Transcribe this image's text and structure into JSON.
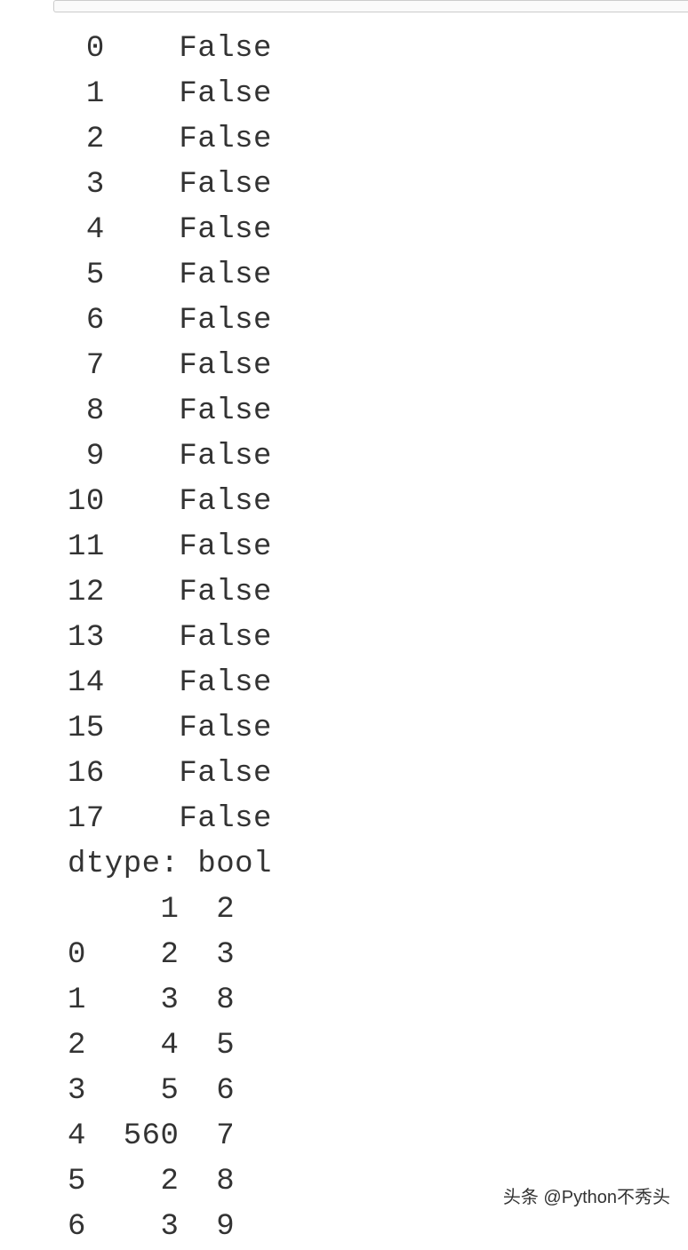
{
  "output": {
    "series": [
      {
        "index": "0",
        "value": "False"
      },
      {
        "index": "1",
        "value": "False"
      },
      {
        "index": "2",
        "value": "False"
      },
      {
        "index": "3",
        "value": "False"
      },
      {
        "index": "4",
        "value": "False"
      },
      {
        "index": "5",
        "value": "False"
      },
      {
        "index": "6",
        "value": "False"
      },
      {
        "index": "7",
        "value": "False"
      },
      {
        "index": "8",
        "value": "False"
      },
      {
        "index": "9",
        "value": "False"
      },
      {
        "index": "10",
        "value": "False"
      },
      {
        "index": "11",
        "value": "False"
      },
      {
        "index": "12",
        "value": "False"
      },
      {
        "index": "13",
        "value": "False"
      },
      {
        "index": "14",
        "value": "False"
      },
      {
        "index": "15",
        "value": "False"
      },
      {
        "index": "16",
        "value": "False"
      },
      {
        "index": "17",
        "value": "False"
      }
    ],
    "dtype_line": "dtype: bool",
    "dataframe": {
      "columns": [
        "1",
        "2"
      ],
      "rows": [
        {
          "index": "0",
          "cells": [
            "2",
            "3"
          ]
        },
        {
          "index": "1",
          "cells": [
            "3",
            "8"
          ]
        },
        {
          "index": "2",
          "cells": [
            "4",
            "5"
          ]
        },
        {
          "index": "3",
          "cells": [
            "5",
            "6"
          ]
        },
        {
          "index": "4",
          "cells": [
            "560",
            "7"
          ]
        },
        {
          "index": "5",
          "cells": [
            "2",
            "8"
          ]
        },
        {
          "index": "6",
          "cells": [
            "3",
            "9"
          ]
        }
      ]
    }
  },
  "watermark": "头条 @Python不秀头"
}
